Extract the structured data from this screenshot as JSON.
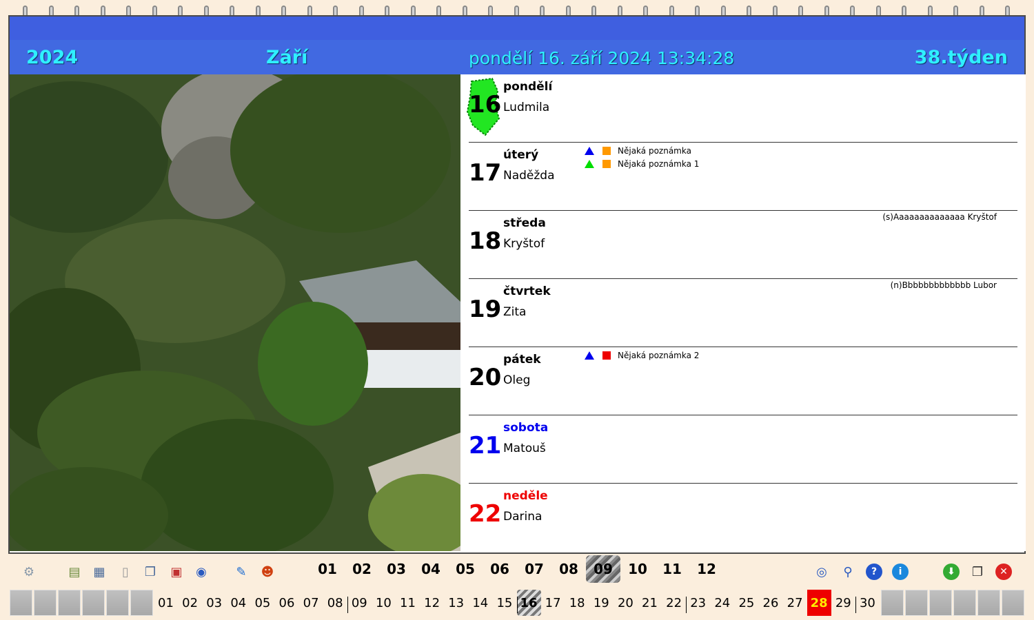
{
  "header": {
    "year": "2024",
    "month": "Září",
    "datetime": "pondělí 16. září 2024 13:34:28",
    "week": "38.týden"
  },
  "days": [
    {
      "num": "16",
      "name": "pondělí",
      "nameday": "Ludmila",
      "today": true
    },
    {
      "num": "17",
      "name": "úterý",
      "nameday": "Naděžda",
      "notes": [
        {
          "tri": "#0000ee",
          "sq": "#ff9900",
          "text": "Nějaká poznámka"
        },
        {
          "tri": "#00dd00",
          "sq": "#ff9900",
          "text": "Nějaká poznámka 1"
        }
      ]
    },
    {
      "num": "18",
      "name": "středa",
      "nameday": "Kryštof",
      "side": "(s)Aaaaaaaaaaaaaa Kryštof"
    },
    {
      "num": "19",
      "name": "čtvrtek",
      "nameday": "Zita",
      "side": "(n)Bbbbbbbbbbbbb Lubor"
    },
    {
      "num": "20",
      "name": "pátek",
      "nameday": "Oleg",
      "notes": [
        {
          "tri": "#0000ee",
          "sq": "#ee0000",
          "text": "Nějaká poznámka 2"
        }
      ]
    },
    {
      "num": "21",
      "name": "sobota",
      "nameday": "Matouš",
      "kind": "sat"
    },
    {
      "num": "22",
      "name": "neděle",
      "nameday": "Darina",
      "kind": "sun"
    }
  ],
  "months": [
    "01",
    "02",
    "03",
    "04",
    "05",
    "06",
    "07",
    "08",
    "09",
    "10",
    "11",
    "12"
  ],
  "selected_month": "09",
  "month_days": [
    "01",
    "02",
    "03",
    "04",
    "05",
    "06",
    "07",
    "08",
    "09",
    "10",
    "11",
    "12",
    "13",
    "14",
    "15",
    "16",
    "17",
    "18",
    "19",
    "20",
    "21",
    "22",
    "23",
    "24",
    "25",
    "26",
    "27",
    "28",
    "29",
    "30"
  ],
  "current_day": "16",
  "highlight_day": "28",
  "tools_left": [
    "settings-gear-icon",
    "notepad-icon",
    "calendar-search-icon",
    "blank-page-icon",
    "copy-pages-icon",
    "calendar-12-icon",
    "numbers-123-icon",
    "edit-pencil-icon",
    "face-smiley-icon"
  ],
  "tools_right": [
    "eyes-icon",
    "magnifier-icon",
    "help-icon",
    "info-icon",
    "download-icon",
    "windows-icon",
    "close-icon"
  ]
}
